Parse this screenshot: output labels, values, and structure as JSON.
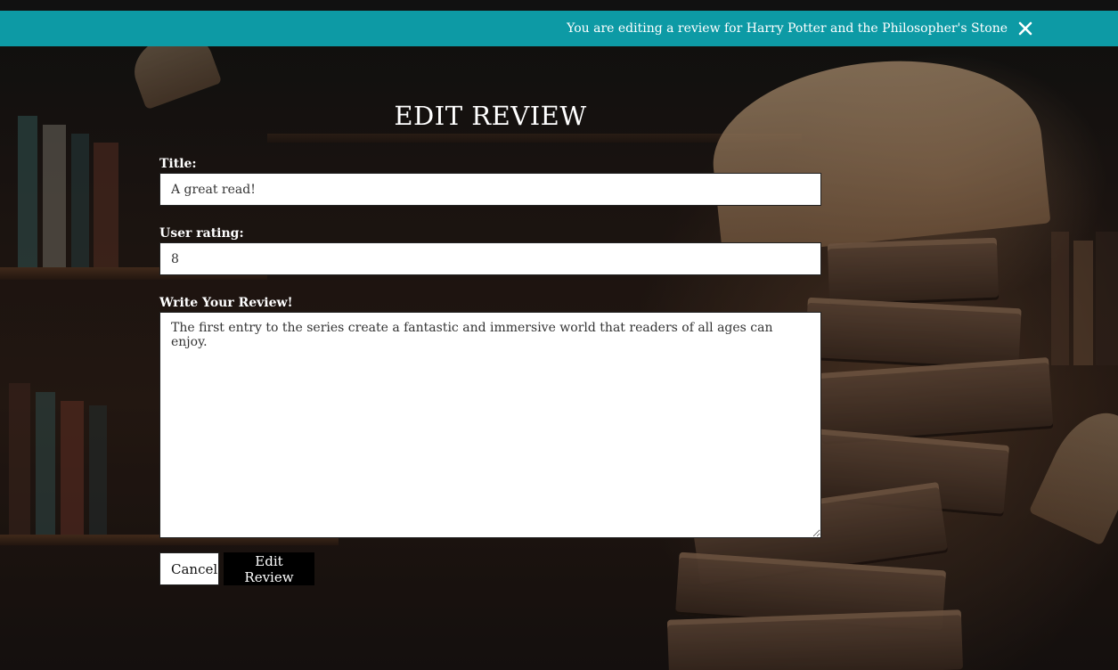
{
  "notice": {
    "message": "You are editing a review for Harry Potter and the Philosopher's Stone",
    "close_icon": "close-icon"
  },
  "form": {
    "heading": "EDIT REVIEW",
    "title_label": "Title:",
    "title_value": "A great read!",
    "rating_label": "User rating:",
    "rating_value": "8",
    "review_label": "Write Your Review!",
    "review_value": "The first entry to the series create a fantastic and immersive world that readers of all ages can enjoy.",
    "cancel_label": "Cancel",
    "submit_label": "Edit Review"
  },
  "colors": {
    "notice_bg": "#0d9aa5",
    "submit_bg": "#000000"
  }
}
